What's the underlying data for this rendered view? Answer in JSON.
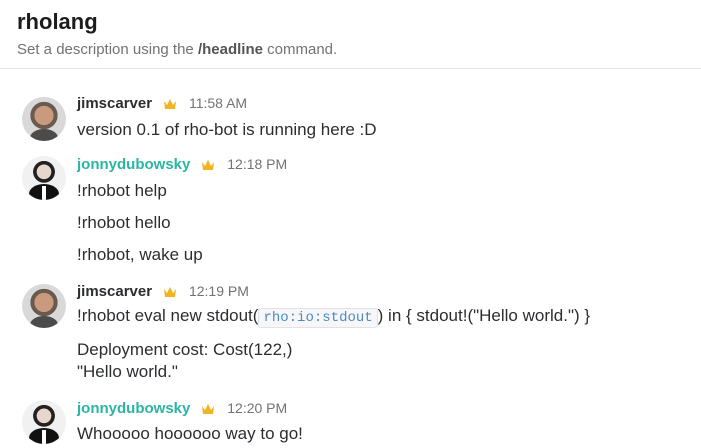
{
  "channel": {
    "name": "rholang",
    "desc_prefix": "Set a description using the ",
    "desc_command": "/headline",
    "desc_suffix": " command."
  },
  "messages": [
    {
      "user": "jimscarver",
      "time": "11:58 AM",
      "lines": [
        "version 0.1 of rho-bot is running here :D"
      ]
    },
    {
      "user": "jonnydubowsky",
      "time": "12:18 PM",
      "lines": [
        "!rhobot help",
        "!rhobot hello",
        "!rhobot, wake up"
      ]
    },
    {
      "user": "jimscarver",
      "time": "12:19 PM",
      "line1_before": "!rhobot eval new stdout(",
      "line1_code": "rho:io:stdout",
      "line1_after": ") in { stdout!(\"Hello world.\") }",
      "line2": "Deployment cost: Cost(122,)",
      "line3": "\"Hello world.\""
    },
    {
      "user": "jonnydubowsky",
      "time": "12:20 PM",
      "lines": [
        "Whooooo hoooooo way to go!"
      ]
    }
  ],
  "colors": {
    "jim_name": "#2c2d30",
    "jonny_name": "#2bb5a3",
    "crown": "#f2b420",
    "code_text": "#4a8bc2"
  },
  "icons": [
    "avatar",
    "crown-icon"
  ]
}
